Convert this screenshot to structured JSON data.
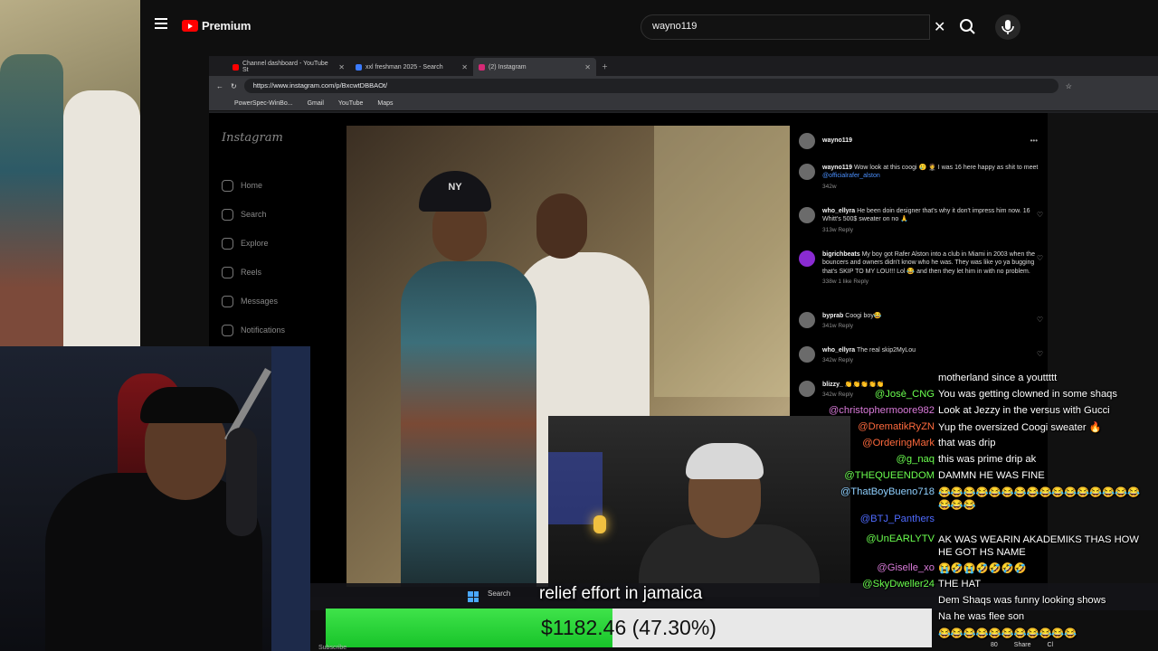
{
  "youtube": {
    "brand": "Premium",
    "search_value": "wayno119"
  },
  "browser": {
    "tabs": [
      {
        "label": "Channel dashboard - YouTube St",
        "color": "#ff0000"
      },
      {
        "label": "xxl freshman 2025 - Search",
        "color": "#3b7bff"
      },
      {
        "label": "(2) Instagram",
        "color": "#d62976"
      }
    ],
    "url": "https://www.instagram.com/p/BxcwtDBBAOt/",
    "bookmarks": [
      "PowerSpec-WinBo...",
      "Gmail",
      "YouTube",
      "Maps"
    ]
  },
  "instagram": {
    "logo": "Instagram",
    "nav": [
      "Home",
      "Search",
      "Explore",
      "Reels",
      "Messages",
      "Notifications"
    ],
    "post_cap_text": "NY",
    "owner": "wayno119",
    "comments": [
      {
        "user": "wayno119",
        "text": "Wow look at this coogi 🥲 🤵 I was 16 here happy as shit to meet",
        "mention": "@officialrafer_alston",
        "meta": "342w"
      },
      {
        "user": "who_ellyra",
        "text": "He been doin designer that's why it don't impress him now. 16 Whitt's 500$ sweater on no 🙏",
        "meta": "313w   Reply"
      },
      {
        "user": "bigrichbeats",
        "text": "My boy got Rafer Alston into a club in Miami in 2003 when the bouncers and owners didn't know who he was. They was like yo ya bugging that's SKIP TO MY LOU!!! Lol 😂 and then they let him in with no problem.",
        "meta": "338w   1 like   Reply"
      },
      {
        "user": "byprab",
        "text": "Coogi boy😂",
        "meta": "341w   Reply"
      },
      {
        "user": "who_ellyra",
        "text": "The real skip2MyLou",
        "meta": "342w   Reply"
      },
      {
        "user": "blizzy_",
        "text": "👏👏👏👏👏",
        "meta": "342w   Reply"
      }
    ]
  },
  "stream": {
    "caption": "relief effort in jamaica",
    "taskbar_search": "Search",
    "donation": {
      "amount_text": "$1182.46 (47.30%)",
      "progress": 0.473
    },
    "subscribe": "Subscribe",
    "actions": [
      "80",
      "Share",
      "Cl"
    ]
  },
  "chat": [
    {
      "user": "",
      "msg": "motherland since a youttttt",
      "color": "#ffffff"
    },
    {
      "user": "@Josè_CNG",
      "msg": "You was getting clowned in some shaqs",
      "color": "#6bff4f"
    },
    {
      "user": "@christophermoore982",
      "msg": "Look at Jezzy in the versus with Gucci",
      "color": "#d97ad9"
    },
    {
      "user": "@DrematikRyZN",
      "msg": "Yup the oversized Coogi sweater 🔥",
      "color": "#ff6a3d"
    },
    {
      "user": "@OrderingMark",
      "msg": "that was drip",
      "color": "#ff6a3d"
    },
    {
      "user": "@g_naq",
      "msg": "this was prime drip ak",
      "color": "#6bff4f"
    },
    {
      "user": "@THEQUEENDOM",
      "msg": "DAMMN HE WAS FINE",
      "color": "#6bff4f"
    },
    {
      "user": "@ThatBoyBueno718",
      "msg": "😂😂😂😂😂😂😂😂😂😂😂😂😂😂😂😂😂😂😂",
      "color": "#8fd0ff"
    },
    {
      "user": "@BTJ_Panthers",
      "msg": "",
      "color": "#4f6bff"
    },
    {
      "user": "@UnEARLYTV",
      "msg": "AK WAS WEARIN AKADEMIKS THAS HOW HE GOT HS NAME",
      "color": "#6bff4f"
    },
    {
      "user": "@Giselle_xo",
      "msg": "😭🤣😭🤣🤣🤣🤣",
      "color": "#d97ad9"
    },
    {
      "user": "@SkyDweller24",
      "msg": "THE HAT",
      "color": "#6bff4f"
    },
    {
      "user": "",
      "msg": "Dem Shaqs was funny looking shows",
      "color": "#ffffff"
    },
    {
      "user": "",
      "msg": "Na he was flee son",
      "color": "#ffffff"
    },
    {
      "user": "",
      "msg": "😂😂😂😂😂😂😂😂😂😂😂",
      "color": "#ffffff"
    }
  ],
  "colors": {
    "accent": "#ff0000",
    "progress": "#2ad63a"
  }
}
